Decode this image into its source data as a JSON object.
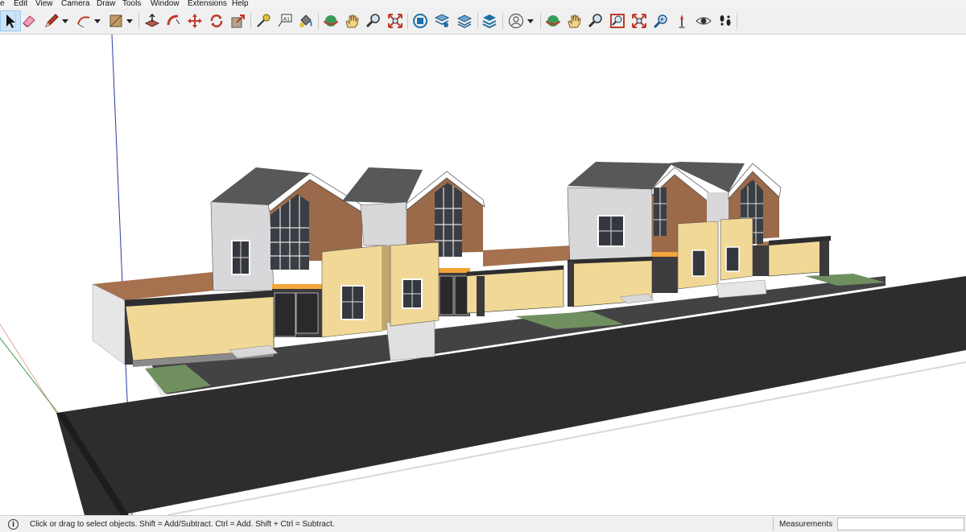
{
  "menu": {
    "items": [
      {
        "label": "e"
      },
      {
        "label": "Edit"
      },
      {
        "label": "View"
      },
      {
        "label": "Camera"
      },
      {
        "label": "Draw"
      },
      {
        "label": "Tools"
      },
      {
        "label": "Window"
      },
      {
        "label": "Extensions"
      },
      {
        "label": "Help"
      }
    ]
  },
  "toolbar": {
    "tools": [
      {
        "name": "select-tool",
        "icon": "arrow-cursor-icon",
        "selected": true
      },
      {
        "name": "eraser-tool",
        "icon": "eraser-icon"
      },
      {
        "name": "pencil-tool",
        "icon": "pencil-icon"
      },
      {
        "name": "pencil-dropdown",
        "icon": "small-down-arrow-icon"
      },
      {
        "name": "arc-tool",
        "icon": "arc-icon"
      },
      {
        "name": "arc-dropdown",
        "icon": "small-down-arrow-icon"
      },
      {
        "name": "rectangle-tool",
        "icon": "rectangle-icon"
      },
      {
        "name": "rectangle-dropdown",
        "icon": "small-down-arrow-icon"
      },
      {
        "name": "push-pull-tool",
        "icon": "push-pull-icon"
      },
      {
        "name": "follow-me-tool",
        "icon": "follow-me-icon"
      },
      {
        "name": "move-tool",
        "icon": "move-icon"
      },
      {
        "name": "rotate-tool",
        "icon": "rotate-icon"
      },
      {
        "name": "scale-tool",
        "icon": "scale-icon"
      },
      {
        "name": "tape-measure-tool",
        "icon": "tape-measure-icon"
      },
      {
        "name": "text-tool",
        "icon": "text-icon"
      },
      {
        "name": "paint-bucket-tool",
        "icon": "paint-bucket-icon"
      },
      {
        "name": "orbit-tool",
        "icon": "orbit-icon"
      },
      {
        "name": "pan-tool",
        "icon": "pan-hand-icon"
      },
      {
        "name": "zoom-tool",
        "icon": "zoom-icon"
      },
      {
        "name": "zoom-extents-tool",
        "icon": "zoom-extents-icon"
      },
      {
        "name": "warehouse-tool",
        "icon": "warehouse-icon"
      },
      {
        "name": "components-tool",
        "icon": "components-icon"
      },
      {
        "name": "layers-tool",
        "icon": "layers-icon"
      },
      {
        "name": "extension-warehouse-tool",
        "icon": "extension-warehouse-icon"
      },
      {
        "name": "account-button",
        "icon": "user-icon"
      },
      {
        "name": "account-dropdown",
        "icon": "small-down-arrow-icon"
      },
      {
        "name": "orbit-tool-2",
        "icon": "orbit-icon"
      },
      {
        "name": "pan-tool-2",
        "icon": "pan-hand-icon"
      },
      {
        "name": "zoom-tool-2",
        "icon": "zoom-icon"
      },
      {
        "name": "zoom-window-tool",
        "icon": "zoom-window-icon"
      },
      {
        "name": "zoom-extents-tool-2",
        "icon": "zoom-extents-icon"
      },
      {
        "name": "previous-view-tool",
        "icon": "previous-view-icon"
      },
      {
        "name": "position-camera-tool",
        "icon": "position-camera-icon"
      },
      {
        "name": "look-around-tool",
        "icon": "eye-icon"
      },
      {
        "name": "walk-tool",
        "icon": "footprints-icon"
      }
    ]
  },
  "status": {
    "info_icon": "i",
    "message": "Click or drag to select objects. Shift = Add/Subtract. Ctrl = Add. Shift + Ctrl = Subtract.",
    "measurements_label": "Measurements",
    "measurements_value": ""
  },
  "colors": {
    "road": "#2d2d2f",
    "yellow_wall": "#f2d896",
    "brick": "#9a6a4a",
    "grey_wall": "#d4d4d6",
    "roof": "#5a5c5e",
    "grass": "#6f8f5f",
    "orange_accent": "#f3a43a",
    "selection_highlight": "#cce4f7"
  }
}
